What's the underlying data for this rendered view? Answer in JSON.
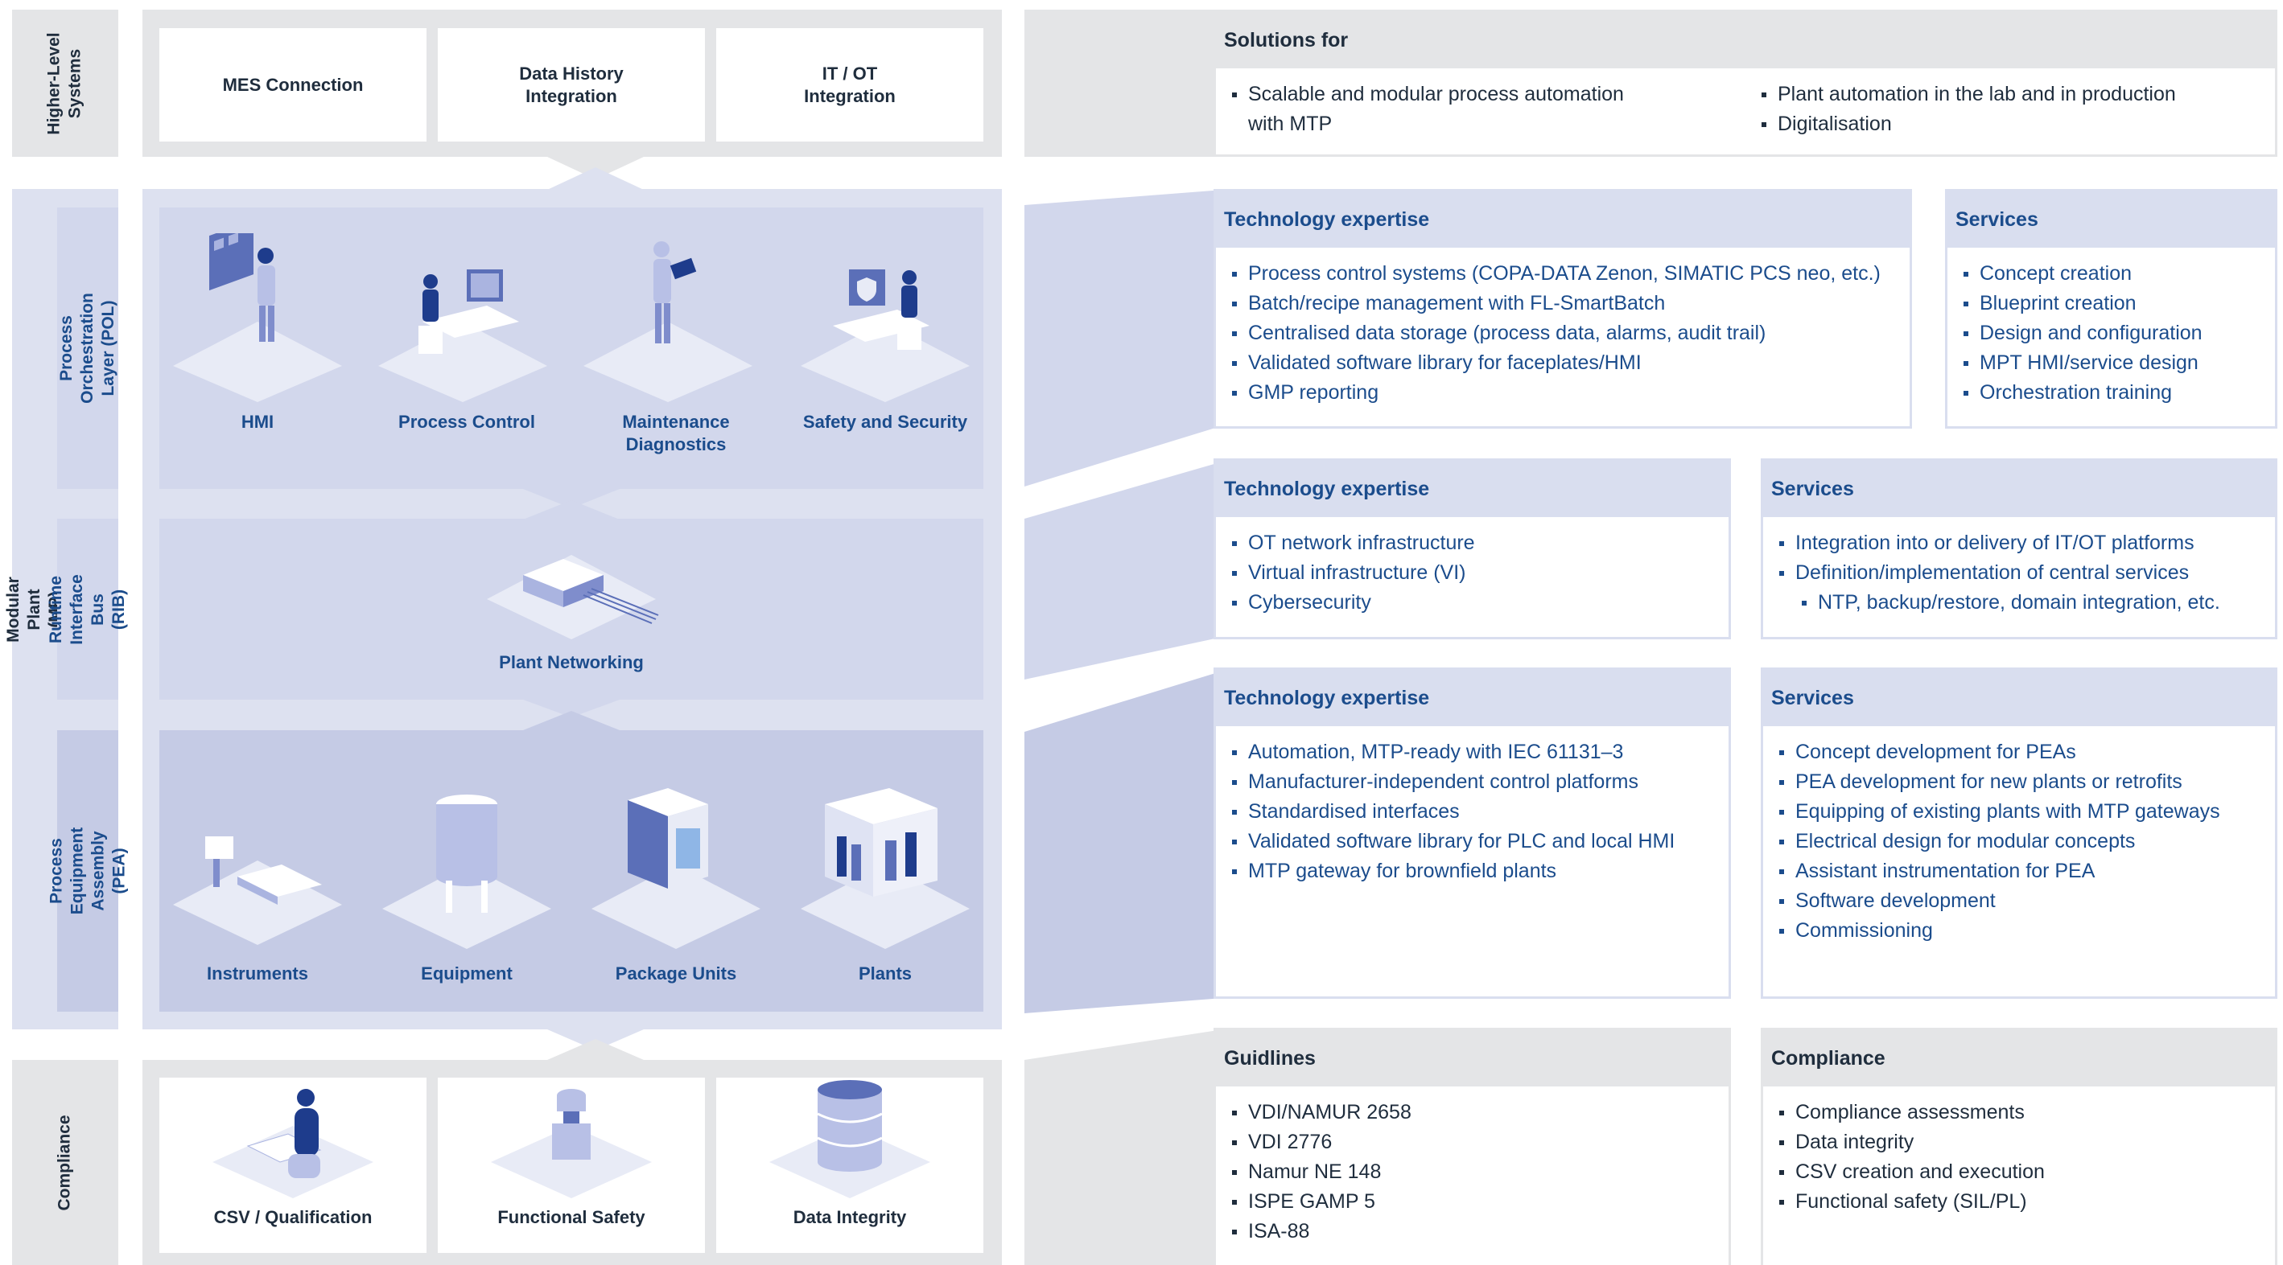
{
  "left_labels": {
    "higher_level": "Higher-Level\nSystems",
    "modular_plant": "Modular Plant (MP)",
    "compliance": "Compliance"
  },
  "layer_labels": {
    "pol": "Process Orchestration\nLayer (POL)",
    "rib": "Runtime Interface\nBus (RIB)",
    "pea": "Process Equipment\nAssembly (PEA)"
  },
  "higher_level_cards": [
    "MES Connection",
    "Data History\nIntegration",
    "IT / OT\nIntegration"
  ],
  "pol_items": [
    "HMI",
    "Process Control",
    "Maintenance\nDiagnostics",
    "Safety and Security"
  ],
  "rib_item": "Plant Networking",
  "pea_items": [
    "Instruments",
    "Equipment",
    "Package Units",
    "Plants"
  ],
  "compliance_cards": [
    "CSV / Qualification",
    "Functional Safety",
    "Data Integrity"
  ],
  "solutions": {
    "title": "Solutions for",
    "col1": [
      "Scalable and modular process automation\nwith MTP"
    ],
    "col2": [
      "Plant automation in the lab and in production",
      "Digitalisation"
    ]
  },
  "pol_tech": {
    "title": "Technology expertise",
    "items": [
      "Process control systems (COPA-DATA Zenon, SIMATIC PCS neo, etc.)",
      "Batch/recipe management with FL-SmartBatch",
      "Centralised data storage (process data, alarms, audit trail)",
      "Validated software library for faceplates/HMI",
      "GMP reporting"
    ]
  },
  "pol_services": {
    "title": "Services",
    "items": [
      "Concept creation",
      "Blueprint creation",
      "Design and configuration",
      "MPT HMI/service design",
      "Orchestration training"
    ]
  },
  "rib_tech": {
    "title": "Technology expertise",
    "items": [
      "OT network infrastructure",
      "Virtual infrastructure (VI)",
      "Cybersecurity"
    ]
  },
  "rib_services": {
    "title": "Services",
    "items": [
      "Integration into or delivery of IT/OT platforms",
      "Definition/implementation of central services"
    ],
    "subitems": [
      "NTP, backup/restore, domain integration, etc."
    ]
  },
  "pea_tech": {
    "title": "Technology expertise",
    "items": [
      "Automation, MTP-ready with IEC 61131–3",
      "Manufacturer-independent control platforms",
      "Standardised interfaces",
      "Validated software library for PLC and local HMI",
      "MTP gateway for brownfield plants"
    ]
  },
  "pea_services": {
    "title": "Services",
    "items": [
      "Concept development for PEAs",
      "PEA development for new plants or retrofits",
      "Equipping of existing plants with MTP gateways",
      "Electrical design for modular concepts",
      "Assistant instrumentation for PEA",
      "Software development",
      "Commissioning"
    ]
  },
  "guidelines": {
    "title": "Guidlines",
    "items": [
      "VDI/NAMUR 2658",
      "VDI 2776",
      "Namur NE 148",
      "ISPE GAMP 5",
      "ISA-88"
    ]
  },
  "compliance_box": {
    "title": "Compliance",
    "items": [
      "Compliance assessments",
      "Data integrity",
      "CSV creation and execution",
      "Functional safety (SIL/PL)"
    ]
  },
  "colors": {
    "grey_band": "#e4e5e7",
    "blue_band": "#dde1f0",
    "blue_panel": "#d2d7ec",
    "pea_panel": "#c5cbe5",
    "text_blue": "#1b4c8c",
    "text_dark": "#1f2d3d"
  }
}
